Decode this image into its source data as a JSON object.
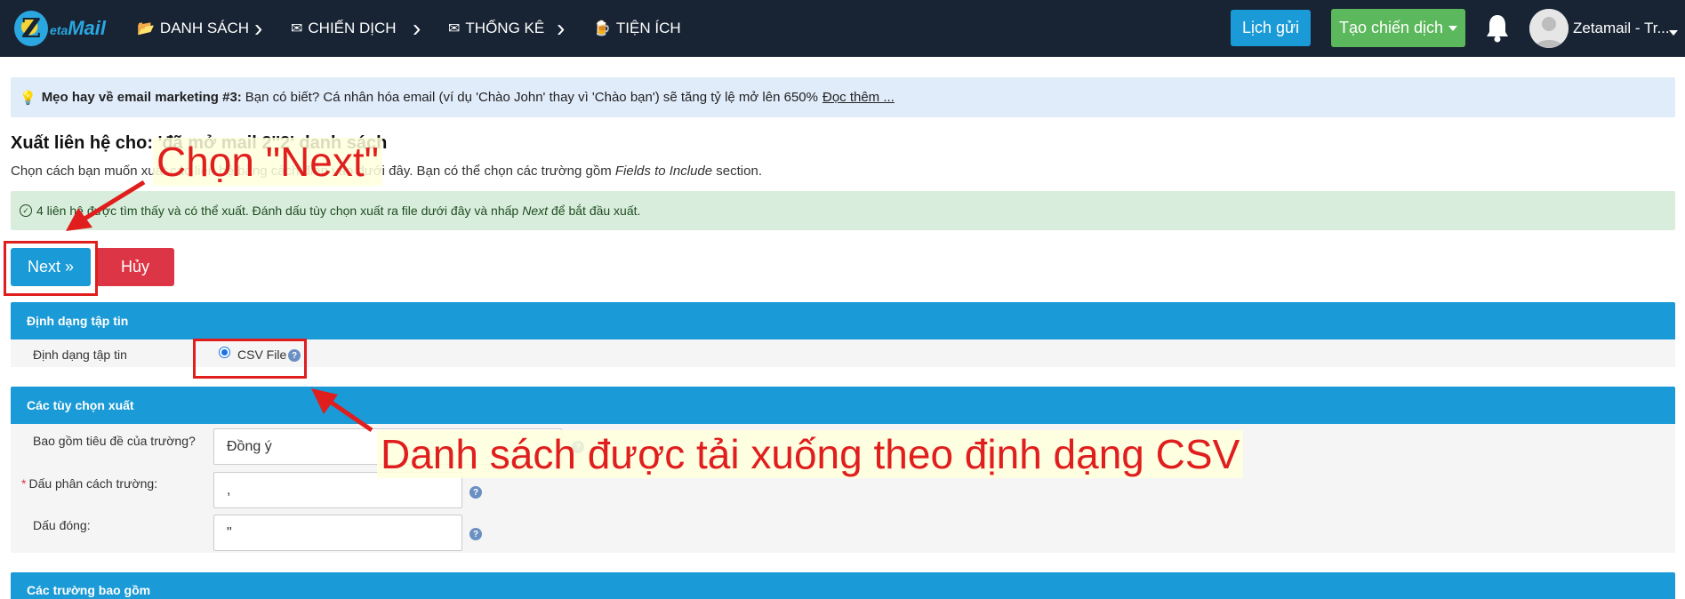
{
  "navbar": {
    "logo": {
      "letter": "Z",
      "text": "eta",
      "text2": "Mail"
    },
    "items": [
      {
        "icon": "📂",
        "label": "DANH SÁCH"
      },
      {
        "icon": "✉",
        "label": "CHIẾN DỊCH"
      },
      {
        "icon": "✉",
        "label": "THỐNG KÊ"
      },
      {
        "icon": "🍺",
        "label": "TIỆN ÍCH"
      }
    ],
    "separator": "›",
    "schedule_button": "Lịch gửi",
    "create_button": "Tạo chiến dịch",
    "user_name": "Zetamail - Tr..."
  },
  "tip": {
    "icon": "💡",
    "title": "Mẹo hay về email marketing #3:",
    "text": "Bạn có biết? Cá nhân hóa email (ví dụ 'Chào John' thay vì 'Chào bạn') sẽ tăng tỷ lệ mở lên 650%",
    "link": "Đọc thêm ..."
  },
  "page": {
    "title": "Xuất liên hệ cho: 'đã mở mail 2''2' danh sách",
    "subtitle_before": "Chọn cách bạn muốn xuất các liên hệ bằng cách điền vào dưới đây. Bạn có thể chọn các trường gồm",
    "subtitle_italic": "Fields to Include",
    "subtitle_after": "section.",
    "success_before": "4 liên hệ được tìm thấy và có thể xuất. Đánh dấu tùy chọn xuất ra file dưới đây và nhấp",
    "success_italic": "Next",
    "success_after": "để bắt đầu xuất."
  },
  "buttons": {
    "next": "Next »",
    "cancel": "Hủy"
  },
  "file_format": {
    "header": "Định dạng tập tin",
    "label": "Định dạng tập tin",
    "option": "CSV File"
  },
  "export_options": {
    "header": "Các tùy chọn xuất",
    "include_header_label": "Bao gồm tiêu đề của trường?",
    "include_header_value": "Đồng ý",
    "separator_required": "*",
    "separator_label": "Dấu phân cách trường:",
    "separator_value": ",",
    "enclosure_label": "Dấu đóng:",
    "enclosure_value": "\""
  },
  "fields_include": {
    "header": "Các trường bao gồm"
  },
  "annotations": {
    "next_hint": "Chọn \"Next\"",
    "csv_hint": "Danh sách được tải xuống theo định dạng CSV"
  },
  "help_glyph": "?",
  "colors": {
    "navbar": "#182433",
    "primary": "#1a9ad6",
    "success": "#5cb85c",
    "danger": "#dc3545",
    "annotation": "#e01e1e"
  }
}
